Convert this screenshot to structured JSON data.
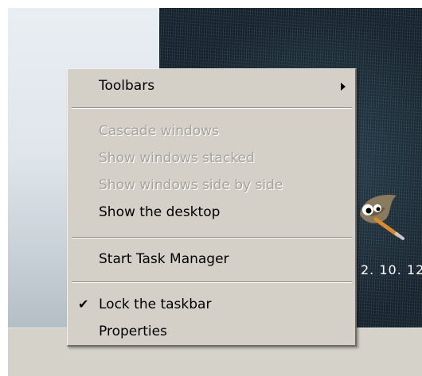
{
  "context_menu": {
    "items": [
      {
        "label": "Toolbars",
        "enabled": true,
        "has_submenu": true
      },
      {
        "label": "Cascade windows",
        "enabled": false
      },
      {
        "label": "Show windows stacked",
        "enabled": false
      },
      {
        "label": "Show windows side by side",
        "enabled": false
      },
      {
        "label": "Show the desktop",
        "enabled": true
      },
      {
        "label": "Start Task Manager",
        "enabled": true
      },
      {
        "label": "Lock the taskbar",
        "enabled": true,
        "checked": true
      },
      {
        "label": "Properties",
        "enabled": true
      }
    ],
    "check_mark": "✔"
  },
  "desktop": {
    "icon_name": "gimp-icon",
    "icon_label": "2. 10. 12"
  }
}
